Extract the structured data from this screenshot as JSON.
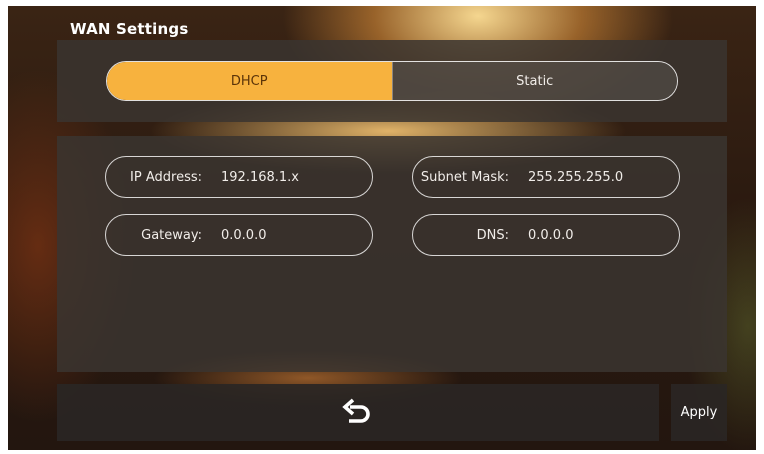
{
  "header": {
    "title": "WAN Settings"
  },
  "mode": {
    "options": [
      {
        "label": "DHCP",
        "selected": true
      },
      {
        "label": "Static",
        "selected": false
      }
    ]
  },
  "fields": {
    "ip_address": {
      "label": "IP Address:",
      "value": "192.168.1.x"
    },
    "subnet_mask": {
      "label": "Subnet Mask:",
      "value": "255.255.255.0"
    },
    "gateway": {
      "label": "Gateway:",
      "value": "0.0.0.0"
    },
    "dns": {
      "label": "DNS:",
      "value": "0.0.0.0"
    }
  },
  "footer": {
    "back_icon": "back-arrow-icon",
    "apply_label": "Apply"
  },
  "colors": {
    "accent": "#f7b23e",
    "panel": "#3a3430",
    "text": "#ffffff"
  }
}
